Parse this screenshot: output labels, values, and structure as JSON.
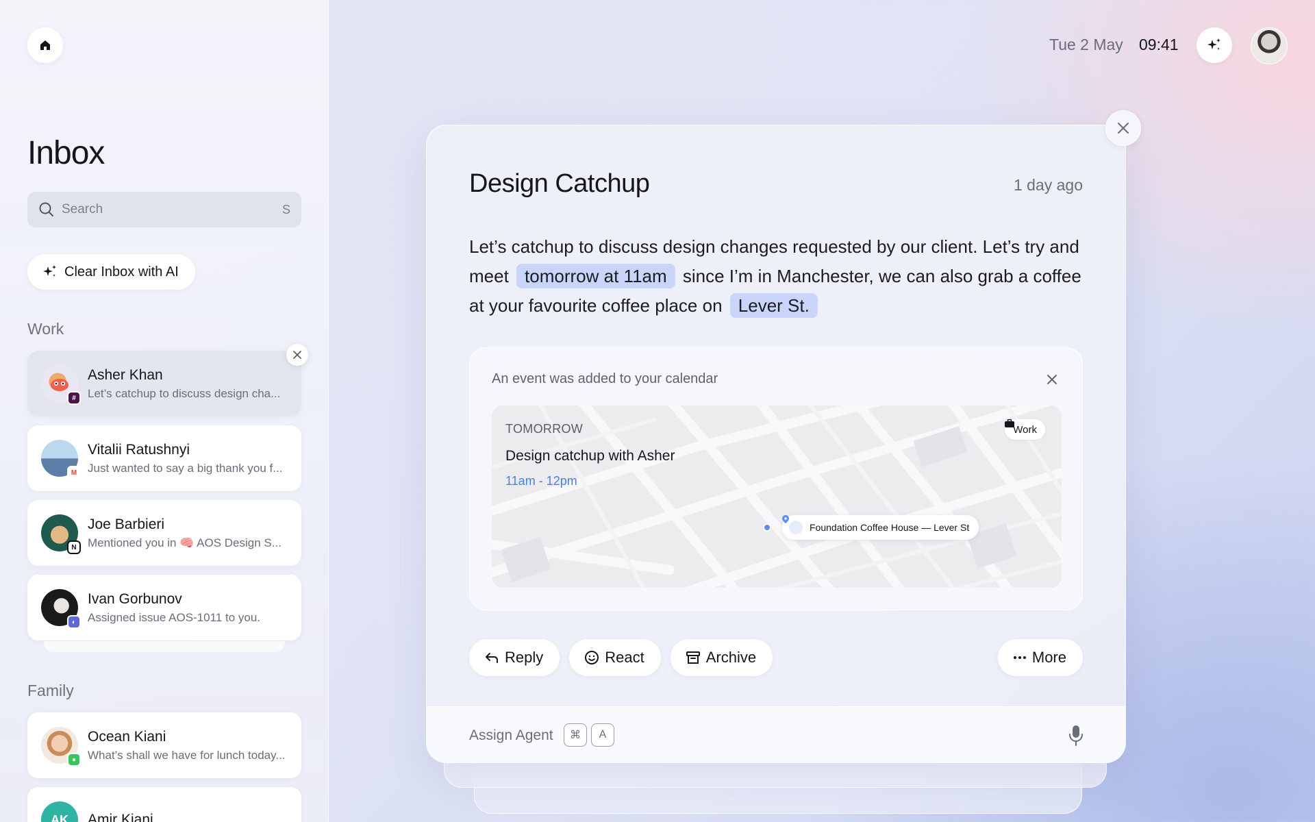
{
  "topbar": {
    "date": "Tue 2 May",
    "time": "09:41"
  },
  "sidebar": {
    "title": "Inbox",
    "search": {
      "placeholder": "Search",
      "shortcut": "S"
    },
    "clear_button": "Clear Inbox with AI",
    "sections": [
      {
        "label": "Work",
        "items": [
          {
            "name": "Asher Khan",
            "preview": "Let’s catchup to discuss design cha...",
            "initials": "",
            "badge": "slack",
            "active": true
          },
          {
            "name": "Vitalii Ratushnyi",
            "preview": "Just wanted to say a big thank you f...",
            "initials": "",
            "badge": "gmail"
          },
          {
            "name": "Joe Barbieri",
            "preview": "Mentioned you in 🧠 AOS Design S...",
            "initials": "",
            "badge": "notion"
          },
          {
            "name": "Ivan Gorbunov",
            "preview": "Assigned issue AOS-1011 to you.",
            "initials": "",
            "badge": "linear"
          }
        ]
      },
      {
        "label": "Family",
        "items": [
          {
            "name": "Ocean Kiani",
            "preview": "What’s shall we have for lunch today...",
            "initials": "",
            "badge": "messages"
          },
          {
            "name": "Amir Kiani",
            "preview": "",
            "initials": "AK",
            "badge": ""
          }
        ]
      }
    ]
  },
  "message": {
    "subject": "Design Catchup",
    "time_ago": "1 day ago",
    "body_part1": "Let’s catchup to discuss design changes requested by our client. Let’s try and meet",
    "body_highlight1": "tomorrow at 11am",
    "body_part2": "since I’m in Manchester, we can also grab a coffee at your favourite coffee place on",
    "body_highlight2": "Lever St.",
    "event": {
      "notice": "An event was added to your calendar",
      "day": "TOMORROW",
      "title": "Design catchup with Asher",
      "time": "11am - 12pm",
      "tag": "Work",
      "location": "Foundation Coffee House — Lever St"
    },
    "actions": {
      "reply": "Reply",
      "react": "React",
      "archive": "Archive",
      "more": "More"
    },
    "assign": {
      "label": "Assign Agent",
      "key1": "⌘",
      "key2": "A"
    }
  },
  "colors": {
    "accent_blue": "#4d7fe0",
    "highlight": "#c9d5fb",
    "slack": "#4a154b",
    "gmail": "#ea4335",
    "notion": "#111111",
    "linear": "#5e6ad2",
    "messages": "#34c759",
    "amir_avatar": "#2fb3a4"
  },
  "icons": [
    "home-icon",
    "search-icon",
    "sparkle-icon",
    "close-icon",
    "briefcase-icon",
    "location-pin-icon",
    "reply-icon",
    "smiley-icon",
    "archive-icon",
    "ellipsis-icon",
    "microphone-icon"
  ]
}
